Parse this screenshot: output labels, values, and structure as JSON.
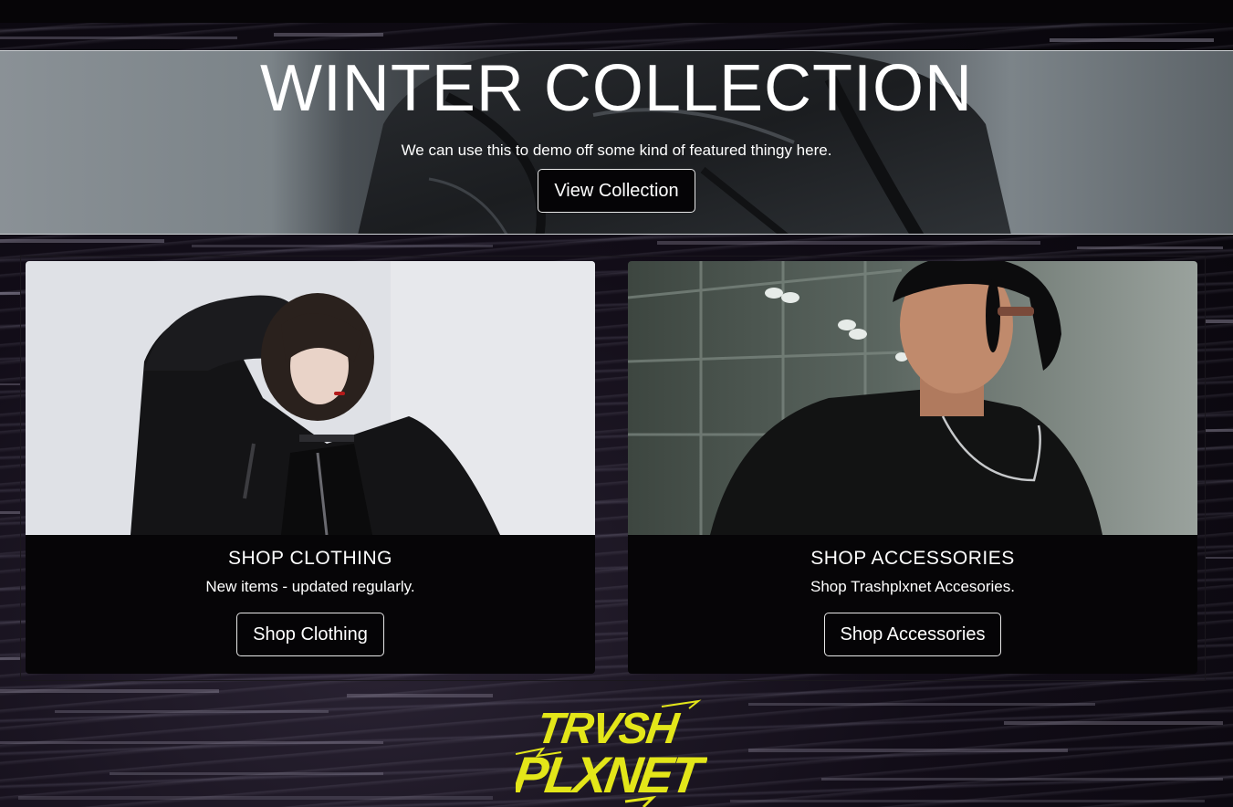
{
  "hero": {
    "title": "WINTER COLLECTION",
    "subtitle": "We can use this to demo off some kind of featured thingy here.",
    "button_label": "View Collection"
  },
  "cards": [
    {
      "title": "SHOP CLOTHING",
      "description": "New items - updated regularly.",
      "button_label": "Shop Clothing"
    },
    {
      "title": "SHOP ACCESSORIES",
      "description": "Shop Trashplxnet Accesories.",
      "button_label": "Shop Accessories"
    }
  ],
  "footer": {
    "logo_text": "TRVSH PLXNET"
  },
  "colors": {
    "logo_yellow": "#e3e619",
    "button_bg": "#050406",
    "button_border": "#e8e8e8",
    "card_bg": "#060507"
  }
}
